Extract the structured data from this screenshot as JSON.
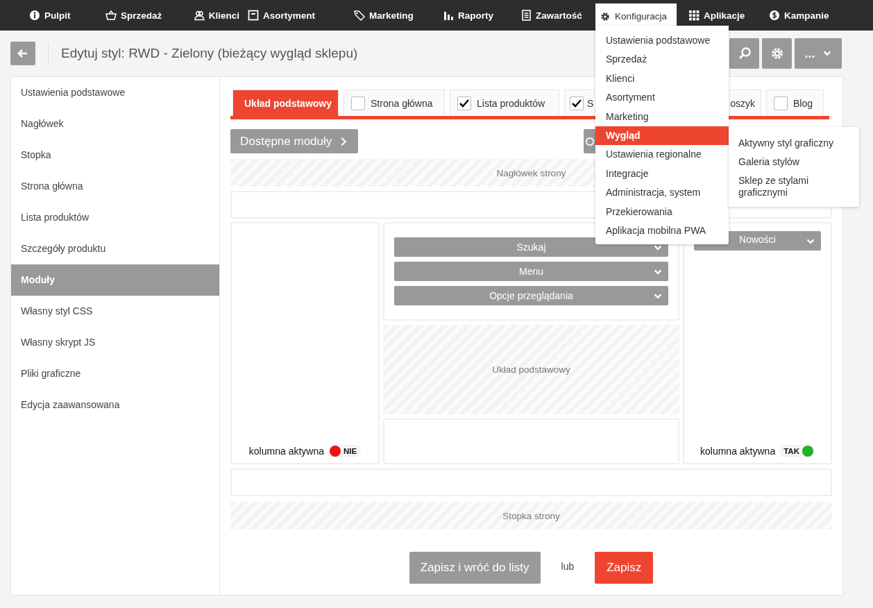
{
  "nav": [
    {
      "label": "Pulpit",
      "selected": false
    },
    {
      "label": "Sprzedaż",
      "selected": false
    },
    {
      "label": "Klienci",
      "selected": false
    },
    {
      "label": "Asortyment",
      "selected": false
    },
    {
      "label": "Marketing",
      "selected": false
    },
    {
      "label": "Raporty",
      "selected": false
    },
    {
      "label": "Zawartość",
      "selected": false
    },
    {
      "label": "Konfiguracja",
      "selected": true
    },
    {
      "label": "Aplikacje",
      "selected": false
    },
    {
      "label": "Kampanie",
      "selected": false
    }
  ],
  "dropdown": {
    "items": [
      {
        "label": "Ustawienia podstawowe",
        "selected": false
      },
      {
        "label": "Sprzedaż",
        "selected": false
      },
      {
        "label": "Klienci",
        "selected": false
      },
      {
        "label": "Asortyment",
        "selected": false
      },
      {
        "label": "Marketing",
        "selected": false
      },
      {
        "label": "Wygląd",
        "selected": true
      },
      {
        "label": "Ustawienia regionalne",
        "selected": false
      },
      {
        "label": "Integracje",
        "selected": false
      },
      {
        "label": "Administracja, system",
        "selected": false
      },
      {
        "label": "Przekierowania",
        "selected": false
      },
      {
        "label": "Aplikacja mobilna PWA",
        "selected": false
      }
    ],
    "submenu": [
      "Aktywny styl graficzny",
      "Galeria stylów",
      "Sklep ze stylami graficznymi"
    ]
  },
  "page_title": "Edytuj styl: RWD - Zielony (bieżący wygląd sklepu)",
  "more_button": "...",
  "sidebar": [
    {
      "label": "Ustawienia podstawowe",
      "selected": false
    },
    {
      "label": "Nagłówek",
      "selected": false
    },
    {
      "label": "Stopka",
      "selected": false
    },
    {
      "label": "Strona główna",
      "selected": false
    },
    {
      "label": "Lista produktów",
      "selected": false
    },
    {
      "label": "Szczegóły produktu",
      "selected": false
    },
    {
      "label": "Moduły",
      "selected": true
    },
    {
      "label": "Własny styl CSS",
      "selected": false
    },
    {
      "label": "Własny skrypt JS",
      "selected": false
    },
    {
      "label": "Pliki graficzne",
      "selected": false
    },
    {
      "label": "Edycja zaawansowana",
      "selected": false
    }
  ],
  "tabs": [
    {
      "kind": "plain",
      "label": "Układ podstawowy",
      "selected": true
    },
    {
      "kind": "checkbox",
      "label": "Strona główna",
      "selected": false,
      "checked": false
    },
    {
      "kind": "checkbox",
      "label": "Lista produktów",
      "selected": false,
      "checked": true
    },
    {
      "kind": "checkbox",
      "label": "S",
      "selected": false,
      "checked": true
    },
    {
      "kind": "plain",
      "label": "oszyk",
      "selected": false
    },
    {
      "kind": "checkbox",
      "label": "Blog",
      "selected": false,
      "checked": false
    }
  ],
  "modules_button": "Dostępne moduły",
  "header_zone": "Nagłówek strony",
  "layout_zone": "Układ podstawowy",
  "footer_zone": "Stopka strony",
  "left_column": {
    "label": "kolumna aktywna",
    "badge": "NIE",
    "active": false
  },
  "center_modules": [
    "Szukaj",
    "Menu",
    "Opcje przeglądania"
  ],
  "right_column": {
    "modules": [
      "Nowości"
    ],
    "label": "kolumna aktywna",
    "badge": "TAK",
    "active": true
  },
  "save_back_button": "Zapisz i wróć do listy",
  "or_text": "lub",
  "save_button": "Zapisz"
}
